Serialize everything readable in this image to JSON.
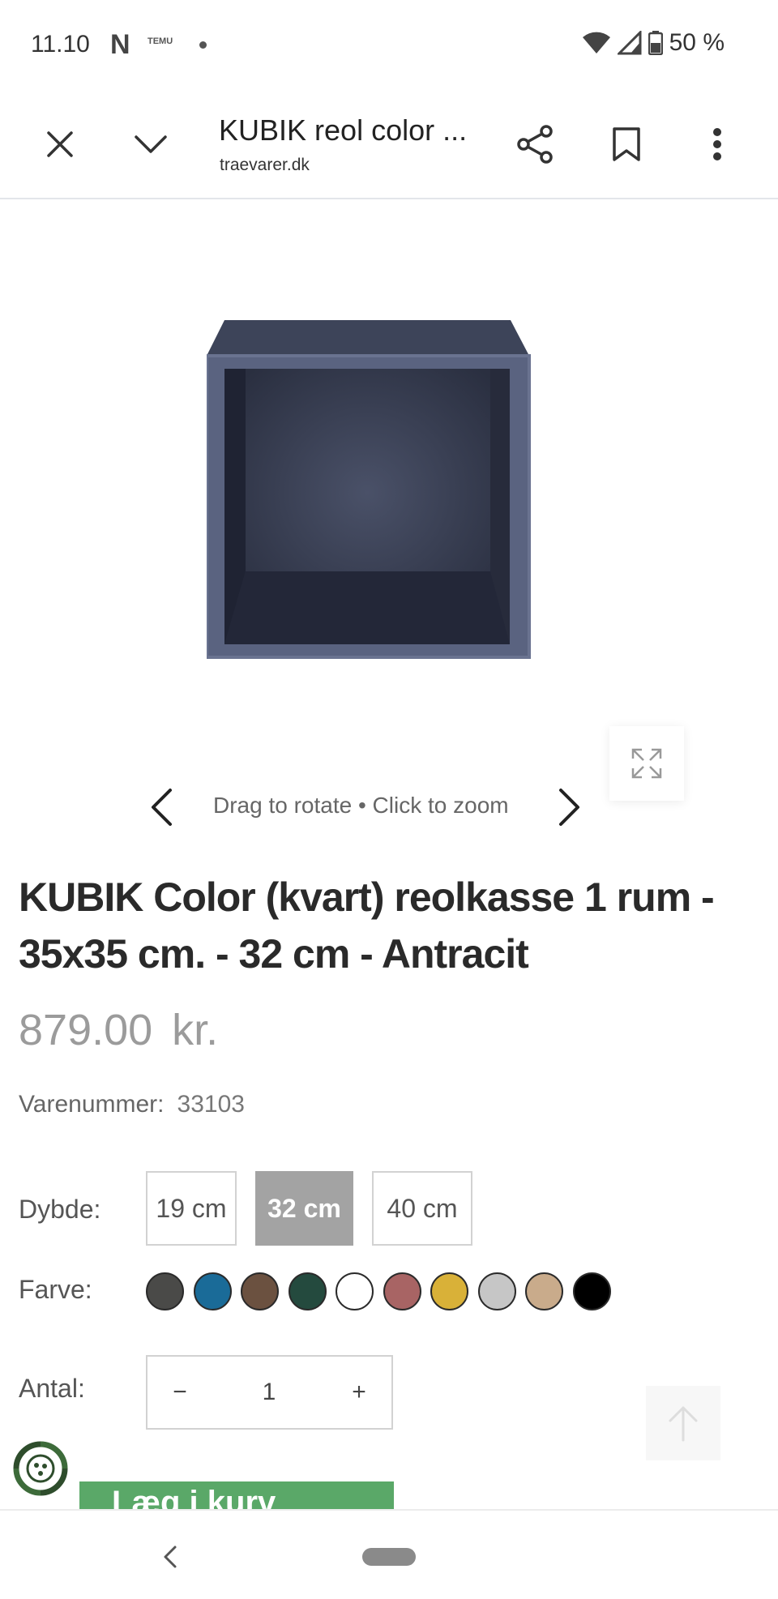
{
  "status_bar": {
    "time": "11.10",
    "notif_n": "N",
    "notif_temu_top": "꧁",
    "notif_temu_bottom": "TEMU",
    "battery_text": "50 %"
  },
  "toolbar": {
    "page_title": "KUBIK reol color ...",
    "url": "traevarer.dk"
  },
  "gallery": {
    "hint": "Drag to rotate • Click to zoom"
  },
  "product": {
    "title": "KUBIK Color (kvart) reolkasse 1 rum - 35x35 cm. - 32 cm - Antracit",
    "price": "879.00",
    "currency": "kr.",
    "sku_label": "Varenummer:",
    "sku_value": "33103",
    "depth_label": "Dybde:",
    "depth_options": [
      "19 cm",
      "32 cm",
      "40 cm"
    ],
    "depth_selected": "32 cm",
    "color_label": "Farve:",
    "colors": [
      "#4a4a48",
      "#1a6b98",
      "#6b5140",
      "#244a3e",
      "#ffffff",
      "#a86464",
      "#d9b138",
      "#c6c6c6",
      "#c9ab8b",
      "#000000"
    ],
    "qty_label": "Antal:",
    "qty_minus": "−",
    "qty_value": "1",
    "qty_plus": "+",
    "cart_button": "Læg i kurv"
  },
  "icons": {
    "close": "close-icon",
    "chevron_down": "chevron-down-icon",
    "share": "share-icon",
    "bookmark": "bookmark-icon",
    "more": "more-vert-icon",
    "expand": "expand-icon",
    "arrow_up": "arrow-up-icon",
    "eco": "eco-badge-icon",
    "back": "back-icon"
  }
}
